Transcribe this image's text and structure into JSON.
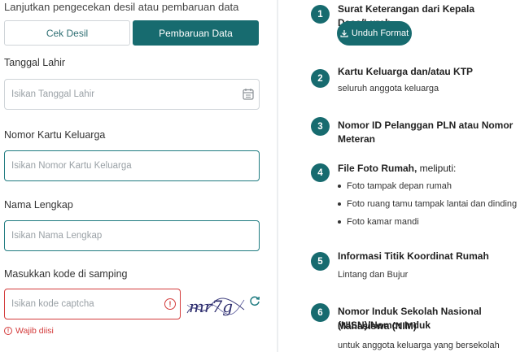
{
  "form": {
    "caption": "Lanjutkan pengecekan desil atau pembaruan data",
    "tabs": {
      "cek": "Cek Desil",
      "update": "Pembaruan Data"
    },
    "birth_date": {
      "label": "Tanggal Lahir",
      "placeholder": "Isikan Tanggal Lahir"
    },
    "kk_number": {
      "label": "Nomor Kartu Keluarga",
      "placeholder": "Isikan Nomor Kartu Keluarga"
    },
    "full_name": {
      "label": "Nama Lengkap",
      "placeholder": "Isikan Nama Lengkap"
    },
    "captcha": {
      "label": "Masukkan kode di samping",
      "placeholder": "Isikan kode captcha",
      "error": "Wajib diisi",
      "image_text": "mr7g"
    }
  },
  "steps": [
    {
      "num": "1",
      "title": "Surat Keterangan dari Kepala Desa/Lurah",
      "button": "Unduh Format"
    },
    {
      "num": "2",
      "title": "Kartu Keluarga dan/atau KTP",
      "sub": "seluruh anggota keluarga"
    },
    {
      "num": "3",
      "title": "Nomor ID Pelanggan PLN atau Nomor Meteran"
    },
    {
      "num": "4",
      "title": "File Foto Rumah,",
      "title_suffix": " meliputi:",
      "bullets": [
        "Foto tampak depan rumah",
        "Foto ruang tamu tampak lantai dan dinding",
        "Foto kamar mandi"
      ]
    },
    {
      "num": "5",
      "title": "Informasi Titik Koordinat Rumah",
      "sub": "Lintang dan Bujur"
    },
    {
      "num": "6",
      "title_line1": "Nomor Induk Sekolah Nasional (NISN)/Nomor Induk",
      "title_line2": "Mahasiswa (NIM)",
      "sub": "untuk anggota keluarga yang bersekolah"
    }
  ],
  "colors": {
    "primary": "#176b6f",
    "error": "#d33a3a",
    "border": "#cfd4d8"
  }
}
